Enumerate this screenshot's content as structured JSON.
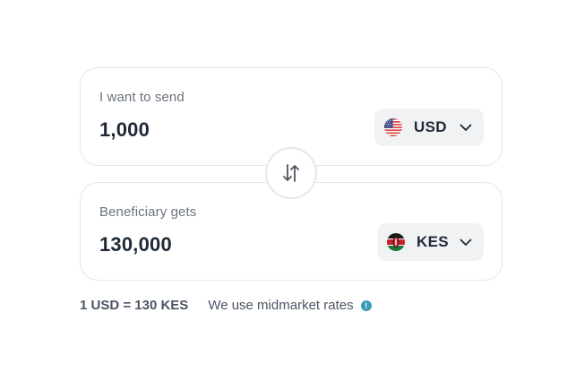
{
  "send": {
    "label": "I want to send",
    "amount": "1,000",
    "currency": {
      "code": "USD",
      "flag_icon": "us-flag-icon"
    }
  },
  "receive": {
    "label": "Beneficiary gets",
    "amount": "130,000",
    "currency": {
      "code": "KES",
      "flag_icon": "kenya-flag-icon"
    }
  },
  "swap": {
    "icon": "swap-arrows-icon"
  },
  "rate": {
    "text": "1 USD = 130 KES",
    "note": "We use midmarket rates",
    "info_icon": "info-icon",
    "info_glyph": "!"
  },
  "colors": {
    "card_border": "#e4e7ec",
    "select_bg": "#f1f2f4",
    "text_primary": "#1f2937",
    "text_secondary": "#6b7280",
    "info_accent": "#3a9bb5"
  }
}
